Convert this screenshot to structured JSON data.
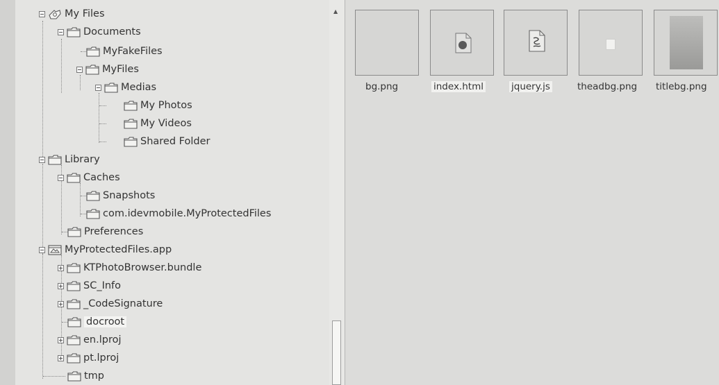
{
  "tree": {
    "root": "My Files",
    "documents": "Documents",
    "my_fake_files": "MyFakeFiles",
    "my_files": "MyFiles",
    "medias": "Medias",
    "my_photos": "My Photos",
    "my_videos": "My Videos",
    "shared_folder": "Shared Folder",
    "library": "Library",
    "caches": "Caches",
    "snapshots": "Snapshots",
    "protected_cache": "com.idevmobile.MyProtectedFiles",
    "preferences": "Preferences",
    "app": "MyProtectedFiles.app",
    "ktphoto": "KTPhotoBrowser.bundle",
    "sc_info": "SC_Info",
    "code_signature": "_CodeSignature",
    "docroot": "docroot",
    "en_lproj": "en.lproj",
    "pt_lproj": "pt.lproj",
    "tmp": "tmp"
  },
  "files": [
    {
      "name": "bg.png"
    },
    {
      "name": "index.html"
    },
    {
      "name": "jquery.js"
    },
    {
      "name": "theadbg.png"
    },
    {
      "name": "titlebg.png"
    }
  ],
  "colors": {
    "tree_bg": "#e4e4e2",
    "files_bg": "#dcdcda",
    "folder_fill": "#f2f2f0",
    "selection": "#f4f4f2"
  }
}
